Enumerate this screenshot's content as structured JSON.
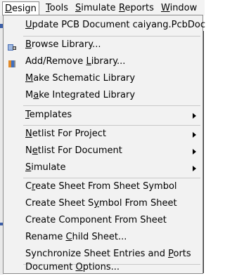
{
  "menubar": {
    "items": [
      {
        "label_pre": "",
        "mnem": "D",
        "label_post": "esign"
      },
      {
        "label_pre": "",
        "mnem": "T",
        "label_post": "ools"
      },
      {
        "label_pre": "",
        "mnem": "S",
        "label_post": "imulate"
      },
      {
        "label_pre": "",
        "mnem": "R",
        "label_post": "eports"
      },
      {
        "label_pre": "",
        "mnem": "W",
        "label_post": "indow"
      }
    ]
  },
  "design_menu": {
    "items": [
      {
        "pre": "",
        "mnem": "U",
        "post": "pdate PCB Document caiyang.PcbDoc"
      },
      {
        "pre": "",
        "mnem": "B",
        "post": "rowse Library..."
      },
      {
        "pre": "Add/Remove ",
        "mnem": "L",
        "post": "ibrary..."
      },
      {
        "pre": "",
        "mnem": "M",
        "post": "ake Schematic Library"
      },
      {
        "pre": "M",
        "mnem": "a",
        "post": "ke Integrated Library"
      },
      {
        "pre": "",
        "mnem": "T",
        "post": "emplates"
      },
      {
        "pre": "",
        "mnem": "N",
        "post": "etlist For Project"
      },
      {
        "pre": "N",
        "mnem": "e",
        "post": "tlist For Document"
      },
      {
        "pre": "",
        "mnem": "S",
        "post": "imulate"
      },
      {
        "pre": "C",
        "mnem": "r",
        "post": "eate Sheet From Sheet Symbol"
      },
      {
        "pre": "Create Sheet S",
        "mnem": "y",
        "post": "mbol From Sheet"
      },
      {
        "pre": "Create Component From Sheet",
        "mnem": "",
        "post": ""
      },
      {
        "pre": "Rename ",
        "mnem": "C",
        "post": "hild Sheet..."
      },
      {
        "pre": "Synchronize Sheet Entries and ",
        "mnem": "P",
        "post": "orts"
      },
      {
        "pre": "Document ",
        "mnem": "O",
        "post": "ptions..."
      }
    ]
  },
  "icons": {
    "browse_library": "library-book-icon",
    "add_remove_library": "library-add-remove-icon"
  },
  "colors": {
    "menu_bg": "#f2f2f2",
    "accent": "#3c5fa8"
  }
}
